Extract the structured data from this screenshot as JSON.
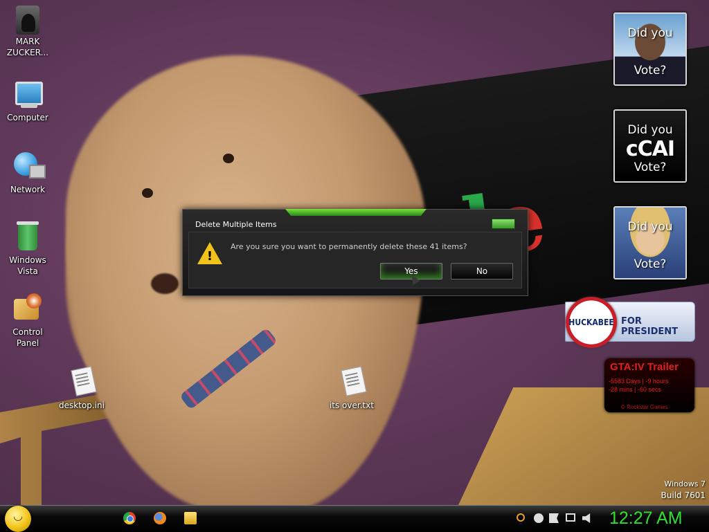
{
  "desktop": {
    "icons": [
      {
        "name": "folder",
        "label": "MARK ZUCKER..."
      },
      {
        "name": "computer",
        "label": "Computer"
      },
      {
        "name": "network",
        "label": "Network"
      },
      {
        "name": "recycle-bin",
        "label": "Windows Vista"
      },
      {
        "name": "control-panel",
        "label": "Control Panel"
      },
      {
        "name": "desktop-ini",
        "label": "desktop.ini"
      },
      {
        "name": "its-over-txt",
        "label": "its over.txt"
      }
    ],
    "build": {
      "line1": "Windows 7",
      "line2": "Build 7601"
    }
  },
  "gadgets": {
    "polls": [
      {
        "name": "obama",
        "top": "Did you",
        "center": "",
        "bottom": "Vote?"
      },
      {
        "name": "ccai",
        "top": "Did you",
        "center": "cCAI",
        "bottom": "Vote?"
      },
      {
        "name": "hillary",
        "top": "Did you",
        "center": "",
        "bottom": "Vote?"
      }
    ],
    "huckabee": {
      "name": "HUCKABEE",
      "tagline": "FOR PRESIDENT"
    },
    "gta": {
      "title": "GTA:IV Trailer",
      "line1": "-5583 Days | -9 hours",
      "line2": "-28 mins | -60 secs",
      "copyright": "© Rockstar Games"
    }
  },
  "dialog": {
    "title": "Delete Multiple Items",
    "message": "Are you sure you want to permanently delete these 41 items?",
    "yes_label": "Yes",
    "no_label": "No",
    "icon": "warning-icon"
  },
  "taskbar": {
    "start_icon": "smiley-start-orb",
    "pinned": [
      "chrome-icon",
      "firefox-icon",
      "explorer-icon"
    ],
    "tray": [
      "search-icon",
      "messenger-icon",
      "action-center-flag-icon",
      "network-icon",
      "volume-icon"
    ],
    "clock": "12:27 AM",
    "accent_color": "#2fe02f"
  }
}
